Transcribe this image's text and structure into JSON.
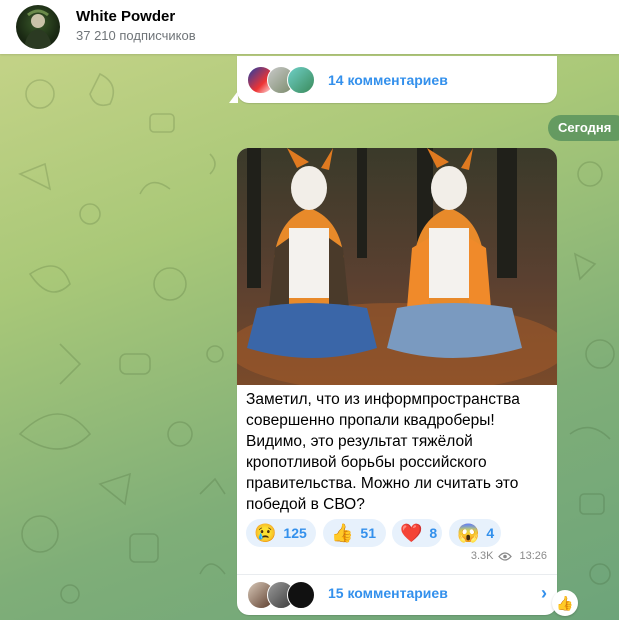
{
  "channel": {
    "name": "White Powder",
    "subscribers": "37 210 подписчиков"
  },
  "previous_post": {
    "comments_label": "14 комментариев"
  },
  "date_separator": "Сегодня",
  "post": {
    "text": "Заметил, что из информпространства\nсовершенно пропали квадроберы!\nВидимо, это результат тяжёлой\nкропотливой борьбы российского\nправительства. Можно ли считать это\nпобедой в СВО?",
    "reactions": [
      {
        "emoji": "😢",
        "icon": "crying-face-icon",
        "count": "125"
      },
      {
        "emoji": "👍",
        "icon": "thumbs-up-icon",
        "count": "51"
      },
      {
        "emoji": "❤️",
        "icon": "heart-icon",
        "count": "8"
      },
      {
        "emoji": "😱",
        "icon": "screaming-face-icon",
        "count": "4"
      }
    ],
    "views": "3.3K",
    "time": "13:26",
    "comments_label": "15 комментариев"
  },
  "quick_reaction": {
    "emoji": "👍",
    "icon": "thumbs-up-icon"
  }
}
